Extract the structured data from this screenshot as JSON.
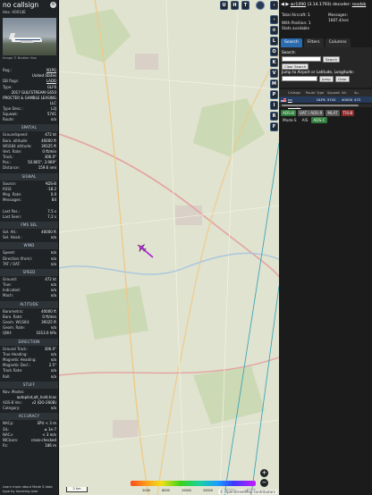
{
  "left_panel": {
    "callsign": "no callsign",
    "hex_line": "Hex: A0014E",
    "photo_credit": "Image © Brother Hoo",
    "info_rows": [
      {
        "k": "Reg.:",
        "v": "N1PG",
        "link": true
      },
      {
        "k": "",
        "v": "United States",
        "link": false
      },
      {
        "k": "DB flags:",
        "v": "LADD",
        "link": true
      },
      {
        "k": "Type:",
        "v": "GLF6",
        "link": false
      }
    ],
    "type_full": "2017 GULFSTREAM G650",
    "owner": "PROCTER & GAMBLE LEASING LLC",
    "info_rows2": [
      {
        "k": "Type Desc.:",
        "v": "L2J"
      },
      {
        "k": "Squawk:",
        "v": "5741"
      },
      {
        "k": "Route:",
        "v": "n/a"
      }
    ],
    "sections": [
      {
        "title": "SPATIAL",
        "rows": [
          {
            "k": "Groundspeed:",
            "v": "472 kt"
          },
          {
            "k": "Baro. altitude:",
            "v": "40000 ft"
          },
          {
            "k": "WGS84 altitude:",
            "v": "39325 ft"
          },
          {
            "k": "Vert. Rate:",
            "v": "0 ft/min"
          },
          {
            "k": "Track:",
            "v": "306.0°"
          },
          {
            "k": "Pos.:",
            "v": "50.805°, 3.969°"
          },
          {
            "k": "Distance:",
            "v": "159.6 nmi"
          }
        ]
      },
      {
        "title": "SIGNAL",
        "rows": [
          {
            "k": "Source:",
            "v": "ADS-B"
          },
          {
            "k": "RSSI:",
            "v": "-18.2"
          },
          {
            "k": "Msg. Rate:",
            "v": "0.0"
          },
          {
            "k": "Messages:",
            "v": "84"
          },
          {
            "k": "",
            "v": ""
          },
          {
            "k": "Last Pos.:",
            "v": "7.5 s"
          },
          {
            "k": "Last Seen:",
            "v": "7.2 s"
          }
        ]
      },
      {
        "title": "FMS SEL",
        "rows": [
          {
            "k": "Sel. Alt.:",
            "v": "40000 ft"
          },
          {
            "k": "Sel. Head.:",
            "v": "n/a"
          }
        ]
      },
      {
        "title": "WIND",
        "rows": [
          {
            "k": "Speed:",
            "v": "n/a"
          },
          {
            "k": "Direction (from):",
            "v": "n/a"
          },
          {
            "k": "TAT / OAT:",
            "v": "n/a"
          }
        ]
      },
      {
        "title": "SPEED",
        "rows": [
          {
            "k": "Ground:",
            "v": "472 kt"
          },
          {
            "k": "True:",
            "v": "n/a"
          },
          {
            "k": "Indicated:",
            "v": "n/a"
          },
          {
            "k": "Mach:",
            "v": "n/a"
          }
        ]
      },
      {
        "title": "ALTITUDE",
        "rows": [
          {
            "k": "Barometric:",
            "v": "40000 ft"
          },
          {
            "k": "Baro. Rate:",
            "v": "0 ft/min"
          },
          {
            "k": "Geom. WGS84:",
            "v": "39325 ft"
          },
          {
            "k": "Geom. Rate:",
            "v": "n/a"
          },
          {
            "k": "QNH:",
            "v": "1013.6 hPa"
          }
        ]
      },
      {
        "title": "DIRECTION",
        "rows": [
          {
            "k": "Ground Track:",
            "v": "306.0°"
          },
          {
            "k": "True Heading:",
            "v": "n/a"
          },
          {
            "k": "Magnetic Heading:",
            "v": "n/a"
          },
          {
            "k": "Magnetic Decl.:",
            "v": "2.5°"
          },
          {
            "k": "Track Rate:",
            "v": "n/a"
          },
          {
            "k": "Roll:",
            "v": "n/a"
          }
        ]
      },
      {
        "title": "STUFF",
        "rows": [
          {
            "k": "Nav. Modes:",
            "v": ""
          },
          {
            "k": "",
            "v": "autopilot,alt_hold,tcas"
          },
          {
            "k": "ADS-B Ver.:",
            "v": "v2 (DO-260B)"
          },
          {
            "k": "Category:",
            "v": "n/a"
          }
        ]
      },
      {
        "title": "ACCURACY",
        "rows": [
          {
            "k": "NACp:",
            "v": "EPU < 3 m"
          },
          {
            "k": "SIL:",
            "v": "≤ 1e-7"
          },
          {
            "k": "NACv:",
            "v": "< 3 m/s"
          },
          {
            "k": "NICbaro:",
            "v": "cross-checked"
          },
          {
            "k": "Rc:",
            "v": "186 m"
          }
        ]
      }
    ],
    "footer": "Learn more about Mode S data type by hovering over"
  },
  "map": {
    "attribution": "© OpenStreetMap contributors",
    "scale_label": "2 km",
    "altbar_labels": [
      "",
      "2000",
      "6000",
      "10000",
      "20000",
      "30000",
      "40000"
    ],
    "zoom_in": "+",
    "zoom_out": "−",
    "top_buttons": [
      "U",
      "H",
      "T"
    ],
    "aircraft_heading_deg": 306
  },
  "strip": {
    "buttons": [
      "L",
      "O",
      "K",
      "V",
      "M",
      "P",
      "I",
      "R",
      "F"
    ]
  },
  "right_panel": {
    "nav_arrows": "◀ ▶",
    "version_link": "wr1090",
    "version_rest": "(3.14.1793) decoder:",
    "version_tail": "readsb",
    "stats": {
      "total_label": "Total Aircraft:",
      "total_value": "1",
      "with_pos_label": "With Position:",
      "with_pos_value": "1",
      "stats_label": "Stats available",
      "messages_label": "Messages:",
      "messages_value": "1687.4/sec"
    },
    "tabs": [
      {
        "label": "Search",
        "active": true
      },
      {
        "label": "Filters",
        "active": false
      },
      {
        "label": "Columns",
        "active": false
      }
    ],
    "search_label": "Search:",
    "search_button": "Search",
    "clear_search": "Clear Search",
    "jump_label": "Jump to Airport or Latitude, Longitude:",
    "jump_button": "Jump",
    "clear_button": "Clear",
    "table": {
      "headers": [
        "",
        "Callsign",
        "Route",
        "Type",
        "Squawk",
        "Alt.",
        "Sp."
      ],
      "row": [
        "",
        "no callsign",
        "",
        "GLF6",
        "5741",
        "40000",
        "472"
      ]
    },
    "tags": [
      {
        "label": "ADS-B",
        "style": "g"
      },
      {
        "label": "UAT / ADS-R",
        "style": "gr"
      },
      {
        "label": "MLAT",
        "style": "gr"
      },
      {
        "label": "TIS-B",
        "style": "r"
      },
      {
        "label": "Mode-S",
        "style": "plain"
      },
      {
        "label": "AIS",
        "style": "plain"
      },
      {
        "label": "ADS-C",
        "style": "g"
      }
    ]
  }
}
